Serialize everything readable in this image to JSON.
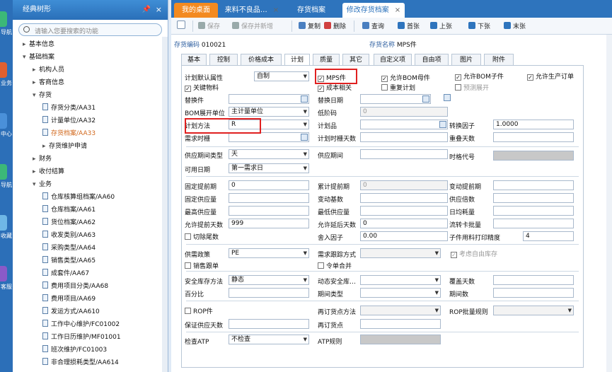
{
  "leftbar": [
    {
      "text": "导航",
      "color": "#3cb878"
    },
    {
      "text": "业务",
      "color": "#e06030"
    },
    {
      "text": "中心",
      "color": "#4a90d9"
    },
    {
      "text": "导航",
      "color": "#3cb878"
    },
    {
      "text": "收藏",
      "color": "#6fb7e6"
    },
    {
      "text": "客服",
      "color": "#8a5ac8"
    }
  ],
  "tree": {
    "title": "经典树形",
    "search_placeholder": "请输入您要搜索的功能",
    "nodes": [
      {
        "label": "基本信息",
        "arrow": "▸",
        "indent": 0,
        "doc": false
      },
      {
        "label": "基础档案",
        "arrow": "▾",
        "indent": 0,
        "doc": false
      },
      {
        "label": "机构人员",
        "arrow": "▸",
        "indent": 1,
        "doc": false
      },
      {
        "label": "客商信息",
        "arrow": "▸",
        "indent": 1,
        "doc": false
      },
      {
        "label": "存货",
        "arrow": "▾",
        "indent": 1,
        "doc": false
      },
      {
        "label": "存货分类/AA31",
        "arrow": "",
        "indent": 2,
        "doc": true
      },
      {
        "label": "计量单位/AA32",
        "arrow": "",
        "indent": 2,
        "doc": true
      },
      {
        "label": "存货档案/AA33",
        "arrow": "",
        "indent": 2,
        "doc": true,
        "selected": true
      },
      {
        "label": "存货维护申请",
        "arrow": "▸",
        "indent": 2,
        "doc": false
      },
      {
        "label": "财务",
        "arrow": "▸",
        "indent": 1,
        "doc": false
      },
      {
        "label": "收付结算",
        "arrow": "▸",
        "indent": 1,
        "doc": false
      },
      {
        "label": "业务",
        "arrow": "▾",
        "indent": 1,
        "doc": false
      },
      {
        "label": "仓库核算组档案/AA60",
        "arrow": "",
        "indent": 2,
        "doc": true
      },
      {
        "label": "仓库档案/AA61",
        "arrow": "",
        "indent": 2,
        "doc": true
      },
      {
        "label": "货位档案/AA62",
        "arrow": "",
        "indent": 2,
        "doc": true
      },
      {
        "label": "收发类别/AA63",
        "arrow": "",
        "indent": 2,
        "doc": true
      },
      {
        "label": "采购类型/AA64",
        "arrow": "",
        "indent": 2,
        "doc": true
      },
      {
        "label": "销售类型/AA65",
        "arrow": "",
        "indent": 2,
        "doc": true
      },
      {
        "label": "成套件/AA67",
        "arrow": "",
        "indent": 2,
        "doc": true
      },
      {
        "label": "费用项目分类/AA68",
        "arrow": "",
        "indent": 2,
        "doc": true
      },
      {
        "label": "费用项目/AA69",
        "arrow": "",
        "indent": 2,
        "doc": true
      },
      {
        "label": "发运方式/AA610",
        "arrow": "",
        "indent": 2,
        "doc": true
      },
      {
        "label": "工作中心维护/FC01002",
        "arrow": "",
        "indent": 2,
        "doc": true
      },
      {
        "label": "工作日历维护/MF01001",
        "arrow": "",
        "indent": 2,
        "doc": true
      },
      {
        "label": "班次维护/FC01003",
        "arrow": "",
        "indent": 2,
        "doc": true
      },
      {
        "label": "非合理损耗类型/AA614",
        "arrow": "",
        "indent": 2,
        "doc": true
      }
    ]
  },
  "tabs": [
    {
      "label": "我的桌面",
      "style": "orange"
    },
    {
      "label": "来料不良品…",
      "style": "normal",
      "close": "×"
    },
    {
      "label": "存货档案",
      "style": "normal"
    },
    {
      "label": "修改存货档案",
      "style": "active",
      "close": "×"
    }
  ],
  "toolbar": [
    {
      "label": "保存",
      "dis": true,
      "color": "#9aa"
    },
    {
      "label": "保存并新增",
      "dis": true,
      "color": "#9aa"
    },
    {
      "label": "复制",
      "dis": false,
      "color": "#4a7fc0"
    },
    {
      "label": "删除",
      "dis": false,
      "color": "#d04040"
    },
    {
      "label": "查询",
      "dis": false,
      "color": "#4a7fc0"
    },
    {
      "label": "首张",
      "dis": false,
      "color": "#2e74bd"
    },
    {
      "label": "上张",
      "dis": false,
      "color": "#2e74bd"
    },
    {
      "label": "下张",
      "dis": false,
      "color": "#2e74bd"
    },
    {
      "label": "末张",
      "dis": false,
      "color": "#2e74bd"
    }
  ],
  "header": {
    "code_label": "存货编码",
    "code_value": "010021",
    "name_label": "存货名称",
    "name_value": "MPS件"
  },
  "subtabs": [
    "基本",
    "控制",
    "价格成本",
    "计划",
    "质量",
    "其它",
    "自定义项",
    "自由项",
    "图片",
    "附件"
  ],
  "form": {
    "plan_attr_label": "计划默认属性",
    "plan_attr_value": "自制",
    "mps_label": "MPS件",
    "allow_bom_parent": "允许BOM母件",
    "allow_bom_child": "允许BOM子件",
    "allow_order": "允许生产订单",
    "key_material": "关键物料",
    "cost_related": "成本相关",
    "repeat_plan": "重复计划",
    "pre_expand": "预测展开",
    "sub_part": "替换件",
    "sub_date": "替换日期",
    "bom_unit_label": "BOM展开单位",
    "bom_unit_value": "主计量单位",
    "low_code": "低阶码",
    "low_code_value": "0",
    "plan_method_label": "计划方法",
    "plan_method_value": "R",
    "plan_item": "计划品",
    "conv_factor": "转换因子",
    "conv_value": "1.0000",
    "demand_fence": "需求时栅",
    "plan_fence_days": "计划时栅天数",
    "overlap_days": "重叠天数",
    "supply_type_label": "供应期间类型",
    "supply_type_value": "天",
    "supply_period": "供应期间",
    "time_code": "时格代号",
    "avail_date_label": "可用日期",
    "avail_date_value": "第一需求日",
    "fixed_lead": "固定提前期",
    "fixed_lead_value": "0",
    "cum_lead": "累计提前期",
    "cum_lead_value": "0",
    "var_lead": "变动提前期",
    "fixed_supply": "固定供应量",
    "var_base": "变动基数",
    "supply_mult": "供应倍数",
    "max_supply": "最高供应量",
    "min_supply": "最低供应量",
    "daily_use": "日均耗量",
    "allow_adv_days": "允许提前天数",
    "allow_adv_value": "999",
    "allow_delay_days": "允许延后天数",
    "allow_delay_value": "0",
    "flow_card": "流转卡批量",
    "cut_tail": "切除尾数",
    "round_factor": "舍入因子",
    "round_value": "0.00",
    "sub_precision": "子件用料打印精度",
    "sub_precision_value": "4",
    "supply_policy": "供需政策",
    "supply_policy_value": "PE",
    "demand_track": "需求跟踪方式",
    "free_stock": "考虑自由库存",
    "sales_bom": "销售跟单",
    "order_merge": "令单合并",
    "safety_method": "安全库存方法",
    "safety_method_value": "静态",
    "dyn_safety": "动态安全库…",
    "cover_days": "覆盖天数",
    "percent": "百分比",
    "period_type": "期间类型",
    "period_count": "期间数",
    "rop": "ROP件",
    "reorder_method": "再订货点方法",
    "rop_batch": "ROP批量规则",
    "guarantee_days": "保证供应天数",
    "reorder_point": "再订货点",
    "check_atp": "检查ATP",
    "check_atp_value": "不检查",
    "atp_rule": "ATP规则"
  }
}
